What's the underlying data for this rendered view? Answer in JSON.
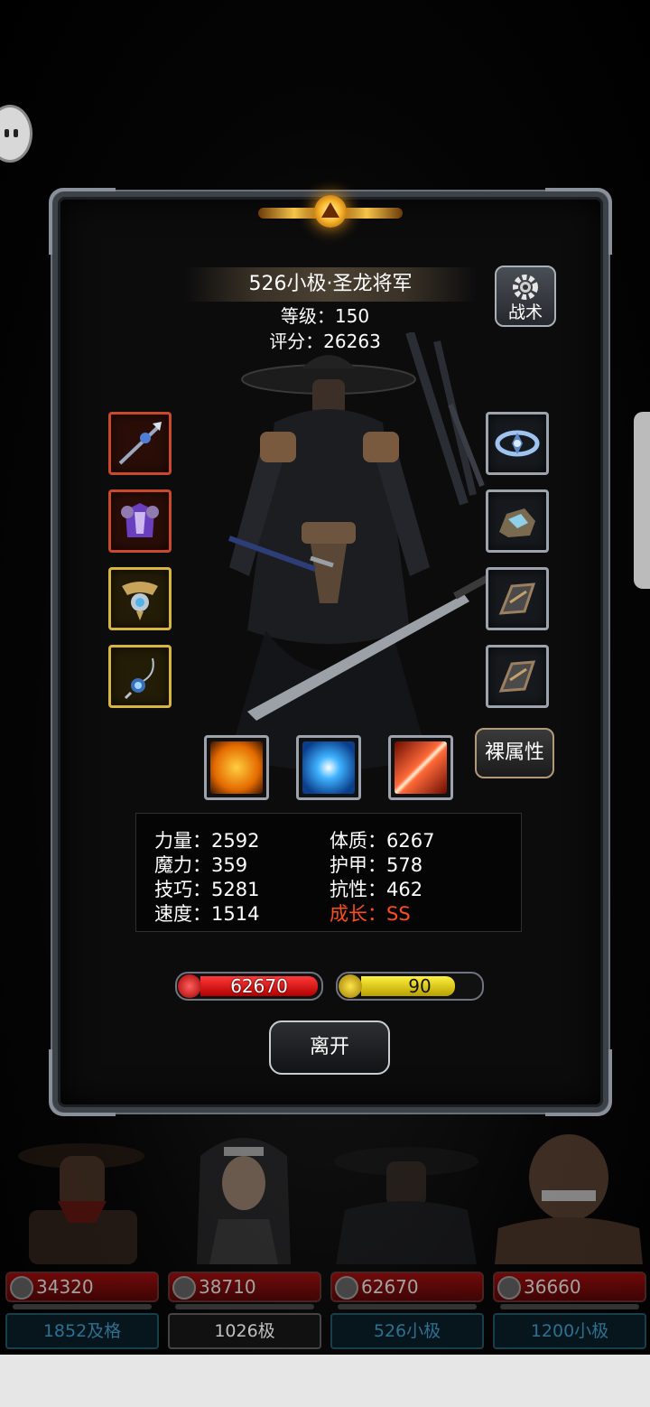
{
  "character": {
    "name": "526小极·圣龙将军",
    "level_text": "等级：150",
    "score_text": "评分：26263"
  },
  "buttons": {
    "tactics_label": "战术",
    "naked_attr_label": "裸属性",
    "leave_label": "离开"
  },
  "equipment": {
    "left": [
      {
        "name": "weapon",
        "frame": "red"
      },
      {
        "name": "armor",
        "frame": "red"
      },
      {
        "name": "amulet",
        "frame": "gold"
      },
      {
        "name": "necklace",
        "frame": "gold"
      }
    ],
    "right": [
      {
        "name": "crown",
        "frame": "gray"
      },
      {
        "name": "ore",
        "frame": "gray"
      },
      {
        "name": "bracer",
        "frame": "gray"
      },
      {
        "name": "bracer",
        "frame": "gray"
      }
    ]
  },
  "skills": [
    "shield-skill",
    "eye-skill",
    "slash-skill"
  ],
  "stats": {
    "strength": "力量：2592",
    "magic": "魔力：359",
    "skill": "技巧：5281",
    "speed": "速度：1514",
    "constitution": "体质：6267",
    "armor": "护甲：578",
    "resistance": "抗性：462",
    "growth": "成长：SS"
  },
  "bars": {
    "hp": "62670",
    "energy": "90",
    "energy_fraction": 0.8
  },
  "colors": {
    "growth": "#ff4d1a",
    "hp": "#d80000",
    "energy": "#e8d400"
  },
  "party": [
    {
      "hp": "34320",
      "name": "1852及格",
      "style": "cyan"
    },
    {
      "hp": "38710",
      "name": "1026极",
      "style": "gray"
    },
    {
      "hp": "62670",
      "name": "526小极",
      "style": "cyan"
    },
    {
      "hp": "36660",
      "name": "1200小极",
      "style": "cyan"
    }
  ]
}
